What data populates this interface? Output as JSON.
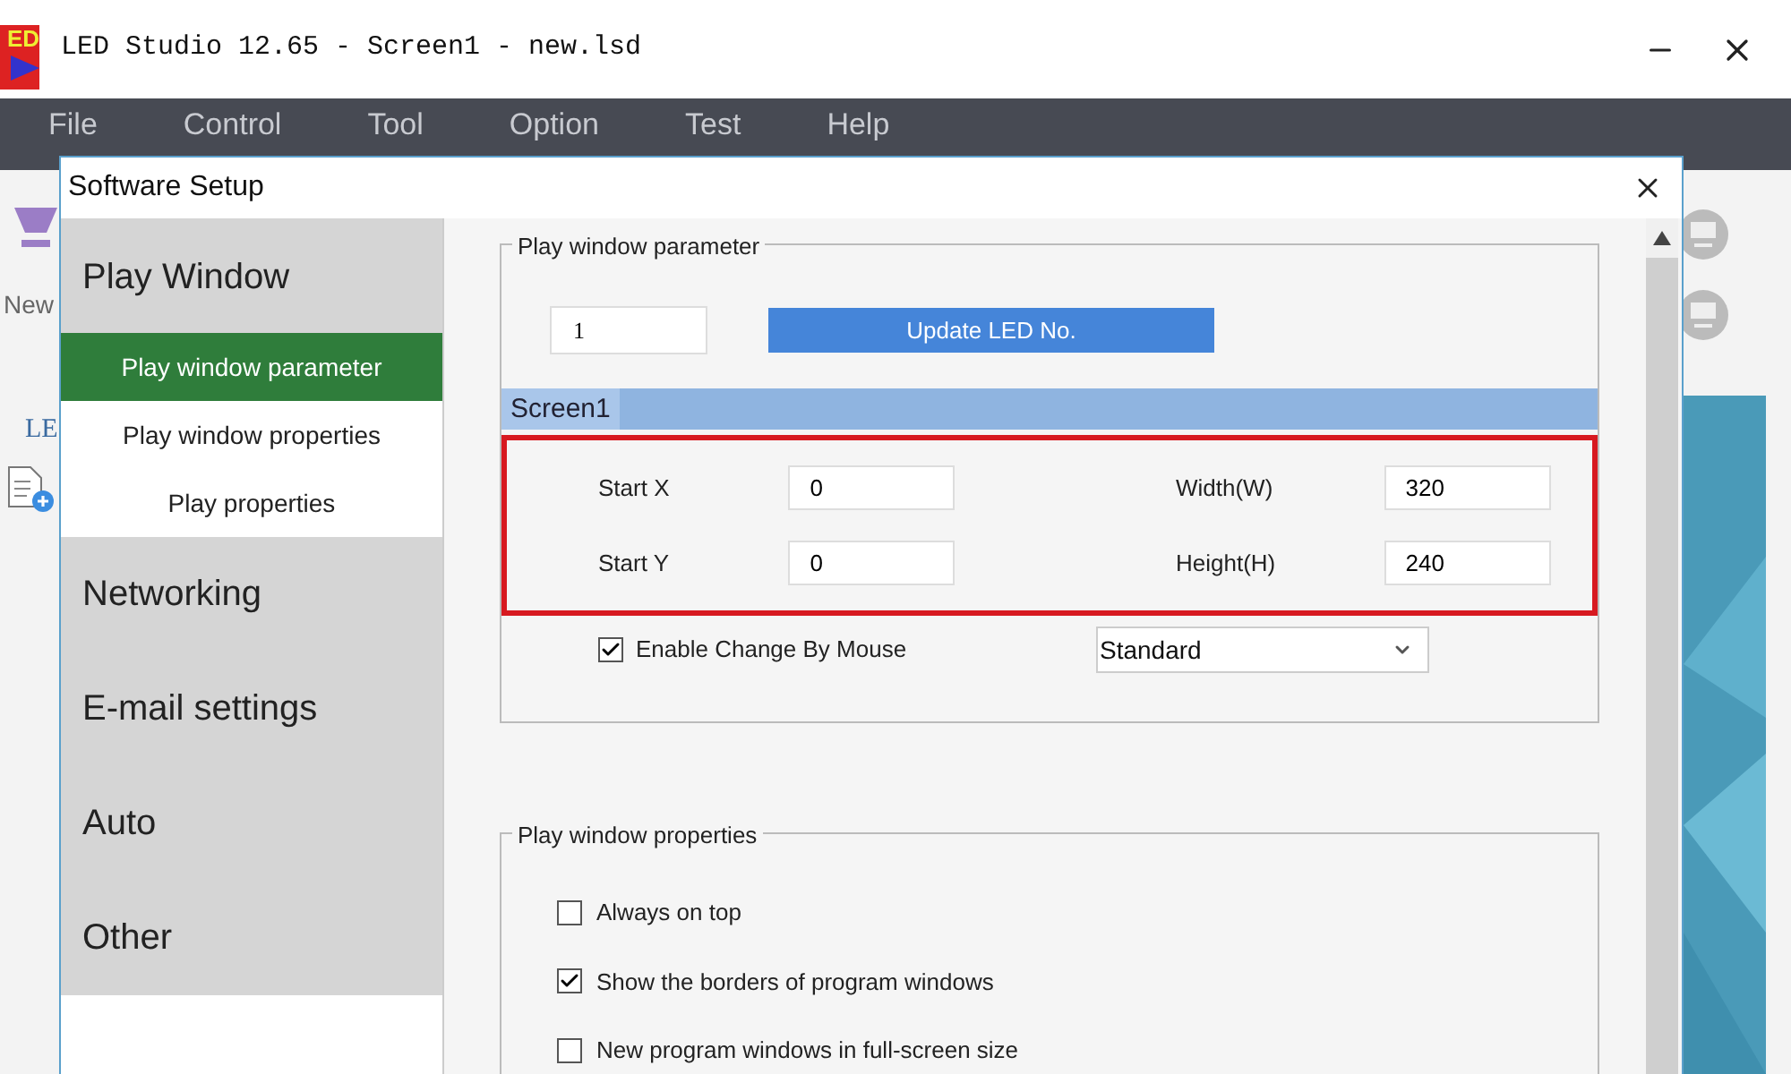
{
  "app": {
    "logo_text": "ED",
    "title": "LED Studio 12.65 - Screen1 - new.lsd",
    "menu": [
      "File",
      "Control",
      "Tool",
      "Option",
      "Test",
      "Help"
    ],
    "side_labels": [
      "New",
      "LE"
    ]
  },
  "dialog": {
    "title": "Software Setup",
    "nav": [
      {
        "label": "Play Window",
        "kind": "section",
        "selected": false
      },
      {
        "label": "Play window parameter",
        "kind": "sub",
        "selected": true
      },
      {
        "label": "Play window properties",
        "kind": "sub",
        "selected": false
      },
      {
        "label": "Play properties",
        "kind": "sub",
        "selected": false
      },
      {
        "label": "Networking",
        "kind": "section",
        "selected": false
      },
      {
        "label": "E-mail settings",
        "kind": "section",
        "selected": false
      },
      {
        "label": "Auto",
        "kind": "section",
        "selected": false
      },
      {
        "label": "Other",
        "kind": "section",
        "selected": false
      }
    ],
    "param": {
      "legend": "Play window parameter",
      "led_no": "1",
      "update_button": "Update LED No.",
      "screen_tab": "Screen1",
      "fields": [
        {
          "label": "Start X",
          "value": "0"
        },
        {
          "label": "Width(W)",
          "value": "320"
        },
        {
          "label": "Start Y",
          "value": "0"
        },
        {
          "label": "Height(H)",
          "value": "240"
        }
      ],
      "enable_mouse": {
        "label": "Enable Change By Mouse",
        "checked": true
      },
      "mode": "Standard"
    },
    "props": {
      "legend": "Play window properties",
      "options": [
        {
          "label": "Always on top",
          "checked": false
        },
        {
          "label": "Show the borders of program windows",
          "checked": true
        },
        {
          "label": "New program windows in full-screen size",
          "checked": false
        }
      ]
    }
  }
}
